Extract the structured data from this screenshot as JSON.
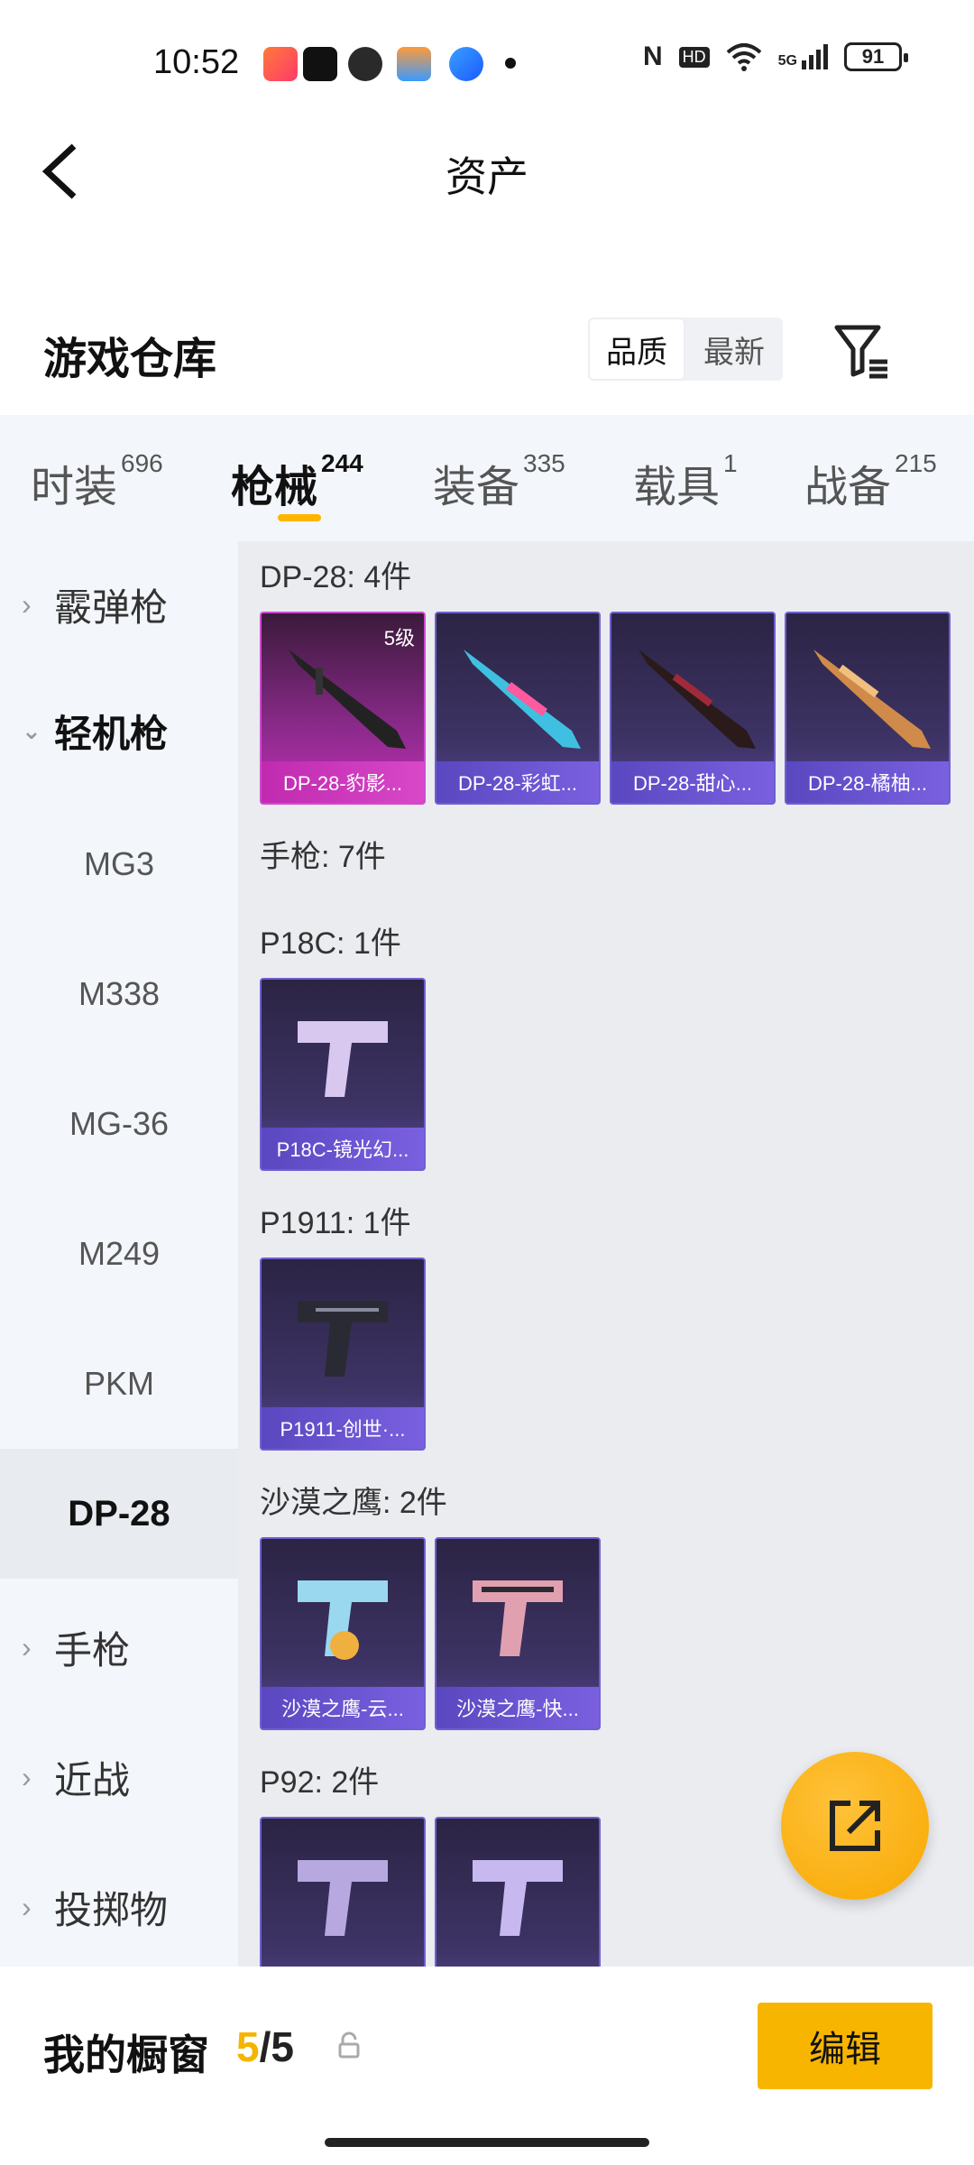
{
  "status_bar": {
    "time": "10:52",
    "battery": "91",
    "app_icons": [
      "game-app-icon",
      "tiktok-icon",
      "wechat-icon",
      "wallet-icon",
      "browser-icon",
      "dot-icon"
    ],
    "right_icons": [
      "nfc-icon",
      "hd-icon",
      "wifi-icon",
      "signal-5g-icon",
      "battery-icon"
    ],
    "hd_label": "HD",
    "net_label": "5G"
  },
  "header": {
    "title": "资产"
  },
  "section": {
    "title": "游戏仓库",
    "sort_options": [
      "品质",
      "最新"
    ],
    "active_sort": "品质"
  },
  "tabs": [
    {
      "label": "时装",
      "count": "696"
    },
    {
      "label": "枪械",
      "count": "244",
      "active": true
    },
    {
      "label": "装备",
      "count": "335"
    },
    {
      "label": "载具",
      "count": "1"
    },
    {
      "label": "战备",
      "count": "215"
    }
  ],
  "sidebar": {
    "categories": [
      {
        "label": "霰弹枪",
        "expanded": false
      },
      {
        "label": "轻机枪",
        "expanded": true
      },
      {
        "label": "手枪",
        "expanded": false
      },
      {
        "label": "近战",
        "expanded": false
      },
      {
        "label": "投掷物",
        "expanded": false
      }
    ],
    "subitems": [
      "MG3",
      "M338",
      "MG-36",
      "M249",
      "PKM",
      "DP-28"
    ],
    "selected_subitem": "DP-28"
  },
  "content": {
    "groups": [
      {
        "label": "DP-28: 4件",
        "items": [
          {
            "name": "DP-28-豹影...",
            "level": "5级",
            "rarity": "gold"
          },
          {
            "name": "DP-28-彩虹...",
            "rarity": "purple"
          },
          {
            "name": "DP-28-甜心...",
            "rarity": "purple"
          },
          {
            "name": "DP-28-橘柚...",
            "rarity": "purple"
          }
        ]
      },
      {
        "label": "手枪: 7件",
        "items": []
      },
      {
        "label": "P18C: 1件",
        "items": [
          {
            "name": "P18C-镜光幻...",
            "rarity": "purple"
          }
        ]
      },
      {
        "label": "P1911: 1件",
        "items": [
          {
            "name": "P1911-创世·...",
            "rarity": "purple"
          }
        ]
      },
      {
        "label": "沙漠之鹰: 2件",
        "items": [
          {
            "name": "沙漠之鹰-云...",
            "rarity": "purple"
          },
          {
            "name": "沙漠之鹰-快...",
            "rarity": "purple"
          }
        ]
      },
      {
        "label": "P92: 2件",
        "items": [
          {
            "name": "",
            "rarity": "purple"
          },
          {
            "name": "",
            "rarity": "purple"
          }
        ]
      }
    ]
  },
  "bottom_bar": {
    "label": "我的橱窗",
    "current": "5",
    "separator": "/",
    "total": "5",
    "edit_label": "编辑"
  },
  "colors": {
    "accent": "#f7b500",
    "purple_card": "#3e3466",
    "gold_card": "#c22fb8"
  }
}
